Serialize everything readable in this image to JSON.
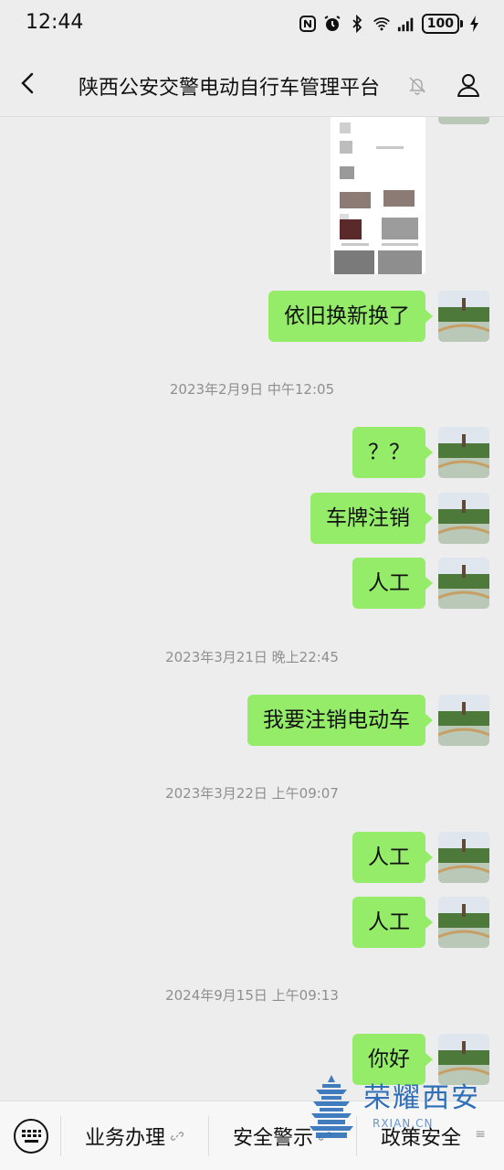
{
  "status_bar": {
    "time": "12:44",
    "battery": "100"
  },
  "header": {
    "title": "陕西公安交警电动自行车管理平台"
  },
  "messages": {
    "m1": "依旧换新换了",
    "t1": "2023年2月9日 中午12:05",
    "m2": "？？",
    "m3": "车牌注销",
    "m4": "人工",
    "t2": "2023年3月21日 晚上22:45",
    "m5": "我要注销电动车",
    "t3": "2023年3月22日 上午09:07",
    "m6": "人工",
    "m7": "人工",
    "t4": "2024年9月15日 上午09:13",
    "m8": "你好"
  },
  "bottom_menu": {
    "item1": "业务办理",
    "item2": "安全警示",
    "item3": "政策安全"
  },
  "watermark": {
    "text": "荣耀西安",
    "url": "RXIAN.CN"
  },
  "colors": {
    "bubble": "#95ec69",
    "background": "#ededed"
  }
}
